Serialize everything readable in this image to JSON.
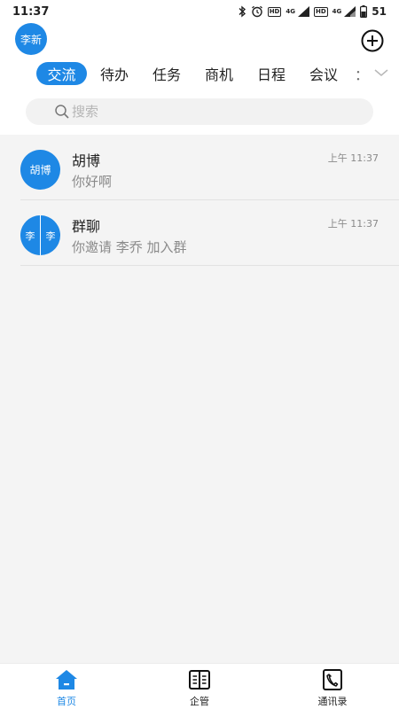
{
  "status_bar": {
    "time": "11:37",
    "net1": "4G",
    "net2": "4G",
    "hd1": "HD",
    "hd2": "HD",
    "battery": "51"
  },
  "header": {
    "user_avatar": "李新"
  },
  "tabs": [
    {
      "label": "交流",
      "active": true
    },
    {
      "label": "待办",
      "active": false
    },
    {
      "label": "任务",
      "active": false
    },
    {
      "label": "商机",
      "active": false
    },
    {
      "label": "日程",
      "active": false
    },
    {
      "label": "会议",
      "active": false
    },
    {
      "label": "：",
      "active": false
    }
  ],
  "search": {
    "placeholder": "搜索"
  },
  "conversations": [
    {
      "avatar": "胡博",
      "name": "胡博",
      "preview": "你好啊",
      "time": "上午 11:37"
    },
    {
      "avatar_left": "李",
      "avatar_right": "李",
      "name": "群聊",
      "preview": "你邀请 李乔 加入群",
      "time": "上午 11:37"
    }
  ],
  "bottom_nav": [
    {
      "label": "首页",
      "active": true
    },
    {
      "label": "企管",
      "active": false
    },
    {
      "label": "通讯录",
      "active": false
    }
  ],
  "colors": {
    "accent": "#1e88e5",
    "background": "#f4f4f4"
  }
}
